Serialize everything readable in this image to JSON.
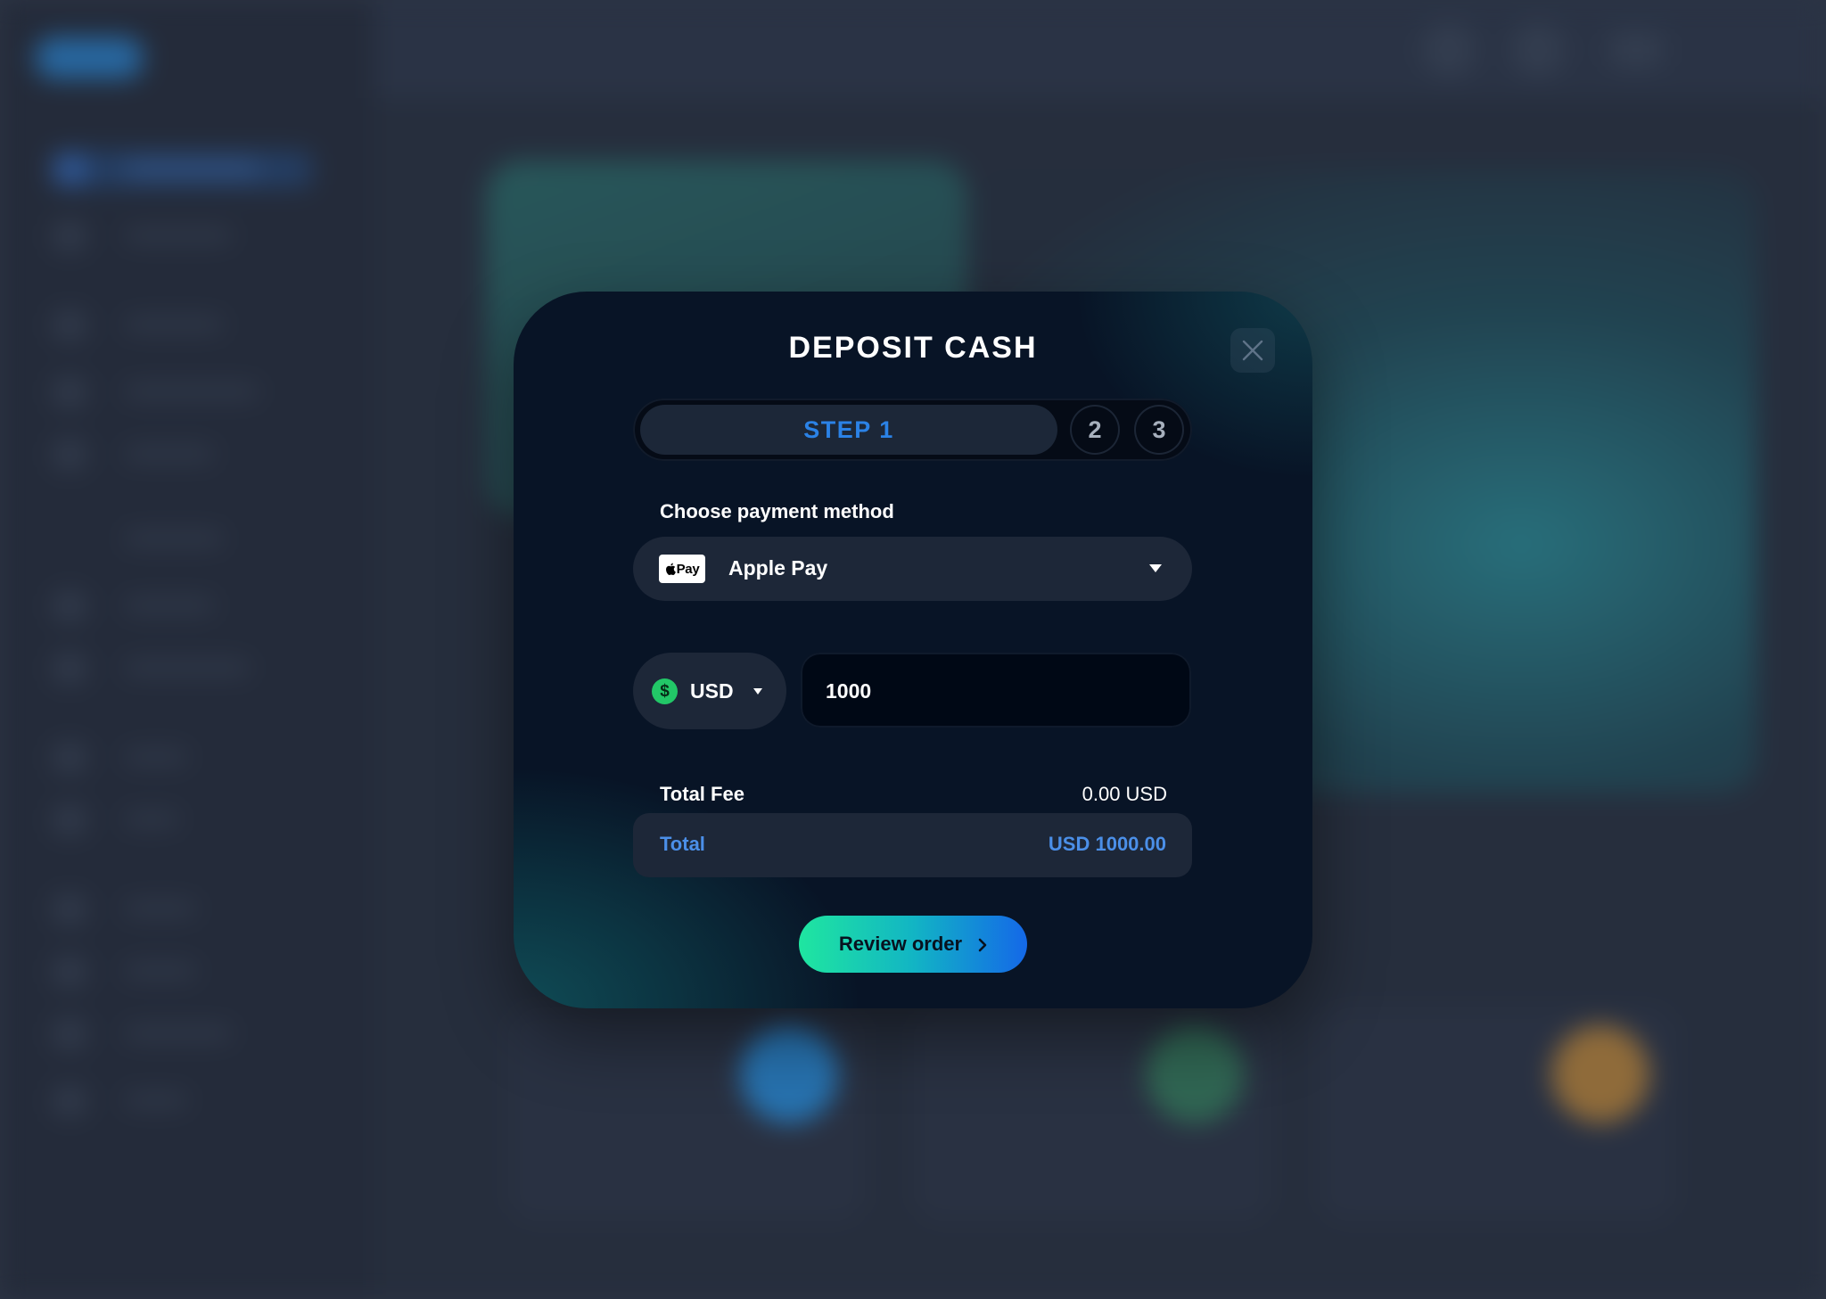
{
  "modal": {
    "title": "DEPOSIT CASH",
    "steps": {
      "active": "STEP 1",
      "second": "2",
      "third": "3"
    },
    "payment": {
      "label": "Choose payment method",
      "badge": "Pay",
      "selected": "Apple Pay"
    },
    "currency": {
      "symbol": "$",
      "selected": "USD"
    },
    "amount": {
      "value": "1000"
    },
    "fee": {
      "label": "Total Fee",
      "value": "0.00 USD"
    },
    "total": {
      "label": "Total",
      "value": "USD 1000.00"
    },
    "review_button": "Review order"
  },
  "colors": {
    "accent_blue": "#2b82e6",
    "total_blue": "#4b8fe8",
    "button_gradient_start": "#1fe6a0",
    "button_gradient_end": "#1468e8",
    "currency_green": "#22c767"
  },
  "icons": {
    "close": "close-icon",
    "method_caret": "caret-down-icon",
    "currency_caret": "caret-down-icon",
    "dollar": "dollar-icon",
    "apple": "apple-logo-icon",
    "review_arrow": "chevron-right-icon"
  }
}
